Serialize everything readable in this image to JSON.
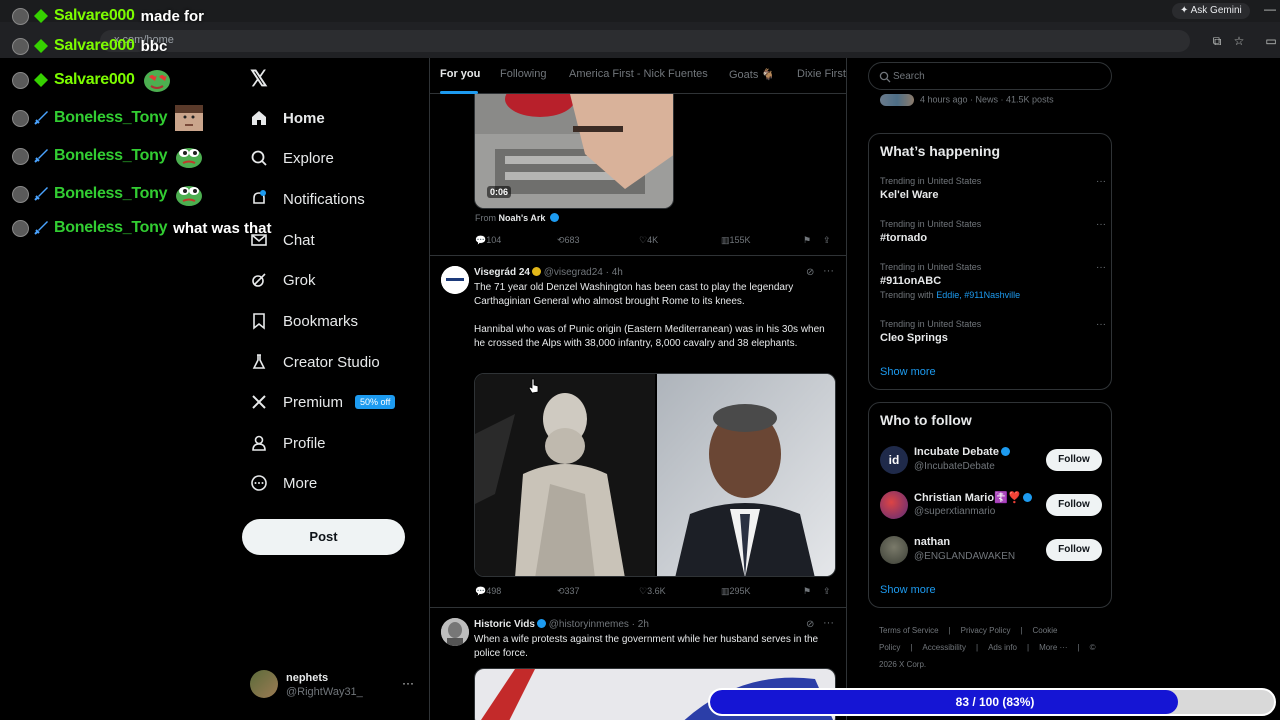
{
  "browser": {
    "address": "x.com/home",
    "ask_gemini": "Ask Gemini"
  },
  "chat": {
    "lines": [
      {
        "user": "Salvare000",
        "message": "made for",
        "user_color": "#7cfc00"
      },
      {
        "user": "Salvare000",
        "message": "bbc",
        "user_color": "#7cfc00"
      },
      {
        "user": "Salvare000",
        "message": "",
        "user_color": "#7cfc00",
        "emote": "pepe-love-emote"
      },
      {
        "user": "Boneless_Tony",
        "message": "",
        "user_color": "#32cd32",
        "emote": "face-emote"
      },
      {
        "user": "Boneless_Tony",
        "message": "",
        "user_color": "#32cd32",
        "emote": "pepe-emote"
      },
      {
        "user": "Boneless_Tony",
        "message": "",
        "user_color": "#32cd32",
        "emote": "pepe-emote"
      },
      {
        "user": "Boneless_Tony",
        "message": "what was that",
        "user_color": "#32cd32"
      }
    ]
  },
  "nav": {
    "items": [
      {
        "label": "Home",
        "icon": "home-icon"
      },
      {
        "label": "Explore",
        "icon": "search-icon"
      },
      {
        "label": "Notifications",
        "icon": "bell-icon"
      },
      {
        "label": "Chat",
        "icon": "mail-icon"
      },
      {
        "label": "Grok",
        "icon": "grok-icon"
      },
      {
        "label": "Bookmarks",
        "icon": "bookmark-icon"
      },
      {
        "label": "Creator Studio",
        "icon": "flask-icon"
      },
      {
        "label": "Premium",
        "icon": "x-icon",
        "badge": "50% off"
      },
      {
        "label": "Profile",
        "icon": "person-icon"
      },
      {
        "label": "More",
        "icon": "more-circle-icon"
      }
    ],
    "post_label": "Post",
    "account": {
      "name": "nephets",
      "handle": "@RightWay31_"
    }
  },
  "tabs": [
    "For you",
    "Following",
    "America First - Nick Fuentes",
    "Goats 🐐",
    "Dixie First"
  ],
  "timeline": {
    "post1": {
      "duration": "0:06",
      "from_label": "From",
      "from_name": "Noah's Ark",
      "replies": "104",
      "reposts": "683",
      "likes": "4K",
      "views": "155K"
    },
    "post2": {
      "name": "Visegrád 24",
      "handle": "@visegrad24 · 4h",
      "text1": "The 71 year old Denzel Washington has been cast to play the legendary Carthaginian General who almost brought Rome to its knees.",
      "text2": "Hannibal who was of Punic origin (Eastern Mediterranean) was in his 30s when he crossed the Alps with 38,000 infantry, 8,000 cavalry and 38 elephants.",
      "replies": "498",
      "reposts": "337",
      "likes": "3.6K",
      "views": "295K"
    },
    "post3": {
      "name": "Historic Vids",
      "handle": "@historyinmemes · 2h",
      "text": "When a wife protests against the government while her husband serves in the police force."
    }
  },
  "right": {
    "search_placeholder": "Search",
    "news_meta": "4 hours ago · News · 41.5K posts",
    "happening_title": "What’s happening",
    "trends": [
      {
        "context": "Trending in United States",
        "title": "Kel'el Ware"
      },
      {
        "context": "Trending in United States",
        "title": "#tornado"
      },
      {
        "context": "Trending in United States",
        "title": "#911onABC",
        "with_label": "Trending with",
        "with_links": "Eddie, #911Nashville"
      },
      {
        "context": "Trending in United States",
        "title": "Cleo Springs"
      }
    ],
    "show_more": "Show more",
    "who_title": "Who to follow",
    "follow_label": "Follow",
    "suggestions": [
      {
        "name": "Incubate Debate",
        "handle": "@IncubateDebate",
        "avatar_text": "id"
      },
      {
        "name": "Christian Mario☦️❣️",
        "handle": "@superxtianmario"
      },
      {
        "name": "nathan",
        "handle": "@ENGLANDAWAKEN"
      }
    ],
    "footer": [
      "Terms of Service",
      "|",
      "Privacy Policy",
      "|",
      "Cookie Policy",
      "|",
      "Accessibility",
      "|",
      "Ads info",
      "|",
      "More ···",
      "|",
      "© 2026 X Corp."
    ]
  },
  "progress": {
    "label": "83 / 100 (83%)",
    "fraction": 0.83,
    "fill_color": "#1515d4"
  }
}
